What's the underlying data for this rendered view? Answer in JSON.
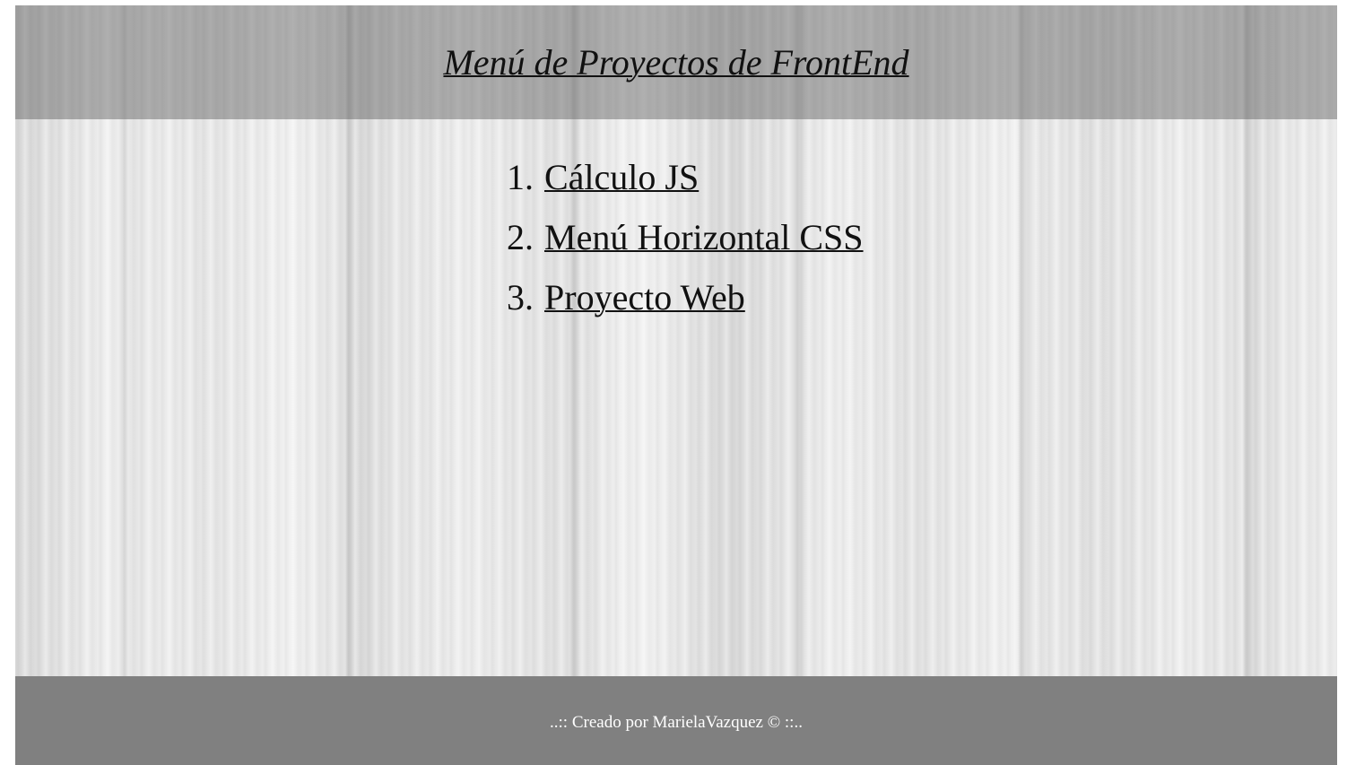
{
  "header": {
    "title": "Menú de Proyectos de FrontEnd"
  },
  "menu": {
    "items": [
      {
        "number": "1.",
        "label": "Cálculo JS"
      },
      {
        "number": "2.",
        "label": "Menú Horizontal CSS"
      },
      {
        "number": "3.",
        "label": "Proyecto Web"
      }
    ]
  },
  "footer": {
    "text": "..:: Creado por MarielaVazquez © ::.."
  },
  "colors": {
    "header_overlay": "#5a5a5a",
    "footer_background": "#808080",
    "footer_text": "#ffffff",
    "text": "#111111"
  }
}
